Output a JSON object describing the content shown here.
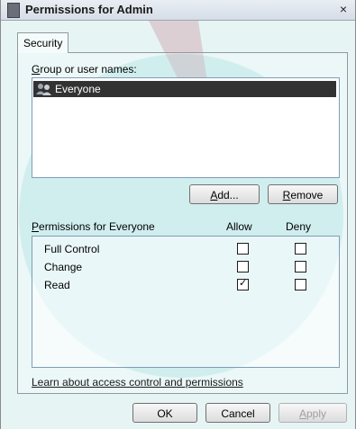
{
  "window": {
    "title": "Permissions for Admin",
    "close_label": "×"
  },
  "tabs": [
    {
      "label": "Security",
      "selected": true
    }
  ],
  "group_section": {
    "label_prefix": "G",
    "label_rest": "roup or user names:",
    "items": [
      {
        "name": "Everyone",
        "selected": true,
        "icon": "users-icon"
      }
    ]
  },
  "buttons": {
    "add_u": "A",
    "add_rest": "dd...",
    "remove_u": "R",
    "remove_rest": "emove",
    "ok": "OK",
    "cancel": "Cancel",
    "apply_u": "A",
    "apply_rest": "pply"
  },
  "permissions": {
    "label_u": "P",
    "label_rest": "ermissions for Everyone",
    "col_allow": "Allow",
    "col_deny": "Deny",
    "rows": [
      {
        "name": "Full Control",
        "allow": false,
        "deny": false
      },
      {
        "name": "Change",
        "allow": false,
        "deny": false
      },
      {
        "name": "Read",
        "allow": true,
        "deny": false
      }
    ]
  },
  "learn_link": "Learn about access control and permissions",
  "check_glyph": "✓"
}
